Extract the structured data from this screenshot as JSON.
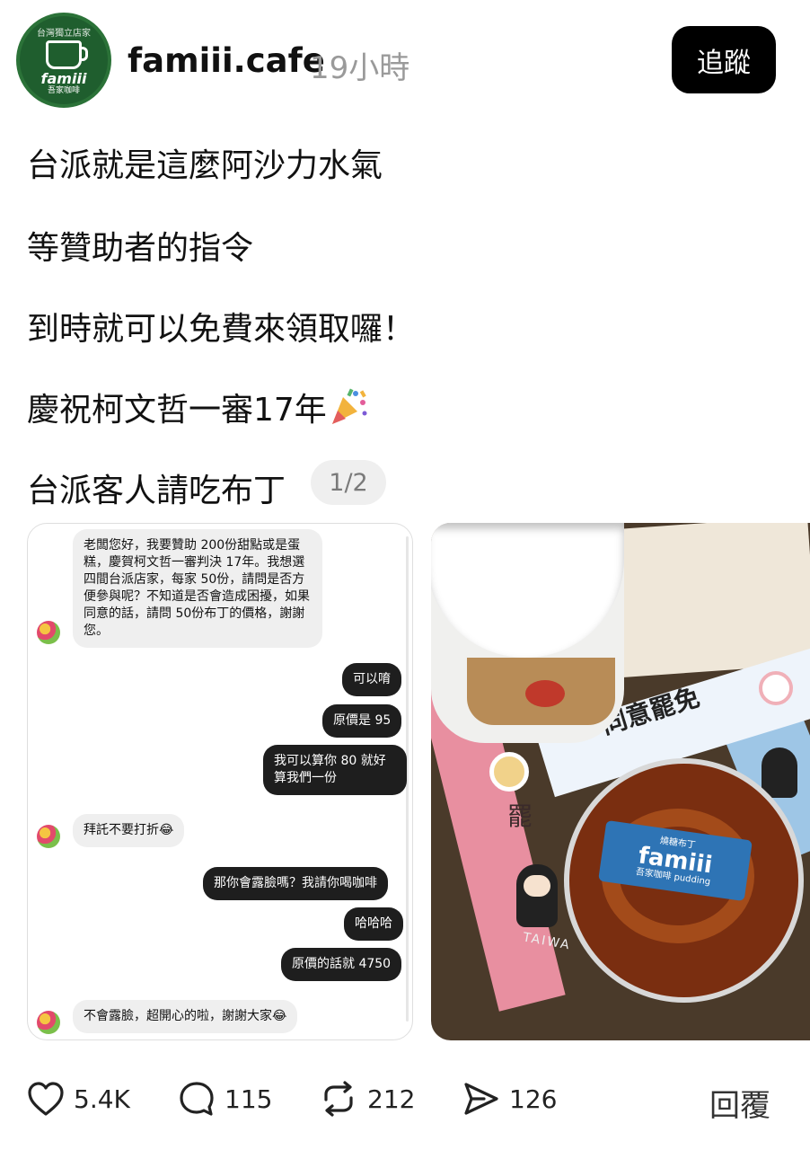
{
  "header": {
    "avatar": {
      "ring_text": "台灣獨立店家",
      "brand": "famiii",
      "sub": "吾家咖啡"
    },
    "username": "famiii.cafe",
    "time": "19小時",
    "follow_label": "追蹤"
  },
  "post": {
    "lines": [
      "台派就是這麼阿沙力水氣",
      "等贊助者的指令",
      "到時就可以免費來領取囉！",
      "慶祝柯文哲一審17年",
      "台派客人請吃布丁"
    ],
    "page_indicator": "1/2"
  },
  "chat": {
    "messages": [
      {
        "side": "in",
        "text": "老闆您好，我要贊助 200份甜點或是蛋糕，慶賀柯文哲一審判決 17年。我想選四間台派店家，每家 50份，請問是否方便參與呢？不知道是否會造成困擾，如果同意的話，請問 50份布丁的價格，謝謝您。"
      },
      {
        "side": "out",
        "text": "可以唷"
      },
      {
        "side": "out",
        "text": "原價是 95"
      },
      {
        "side": "out",
        "text": "我可以算你 80 就好算我們一份"
      },
      {
        "side": "in",
        "text": "拜託不要打折😂"
      },
      {
        "side": "out",
        "text": "那你會露臉嗎？我請你喝咖啡"
      },
      {
        "side": "out",
        "text": "哈哈哈"
      },
      {
        "side": "out",
        "text": "原價的話就 4750"
      },
      {
        "side": "in",
        "text": "不會露臉，超開心的啦，謝謝大家😂"
      }
    ]
  },
  "photo": {
    "ribbon_text": "同意罷免",
    "pink_text": "罷",
    "taiwan_text": "TAIWA",
    "card_brand": "famiii",
    "card_sub": "吾家咖啡 pudding",
    "card_tag": "燒糖布丁"
  },
  "actions": {
    "likes": "5.4K",
    "comments": "115",
    "reposts": "212",
    "shares": "126",
    "reply_label": "回覆"
  }
}
